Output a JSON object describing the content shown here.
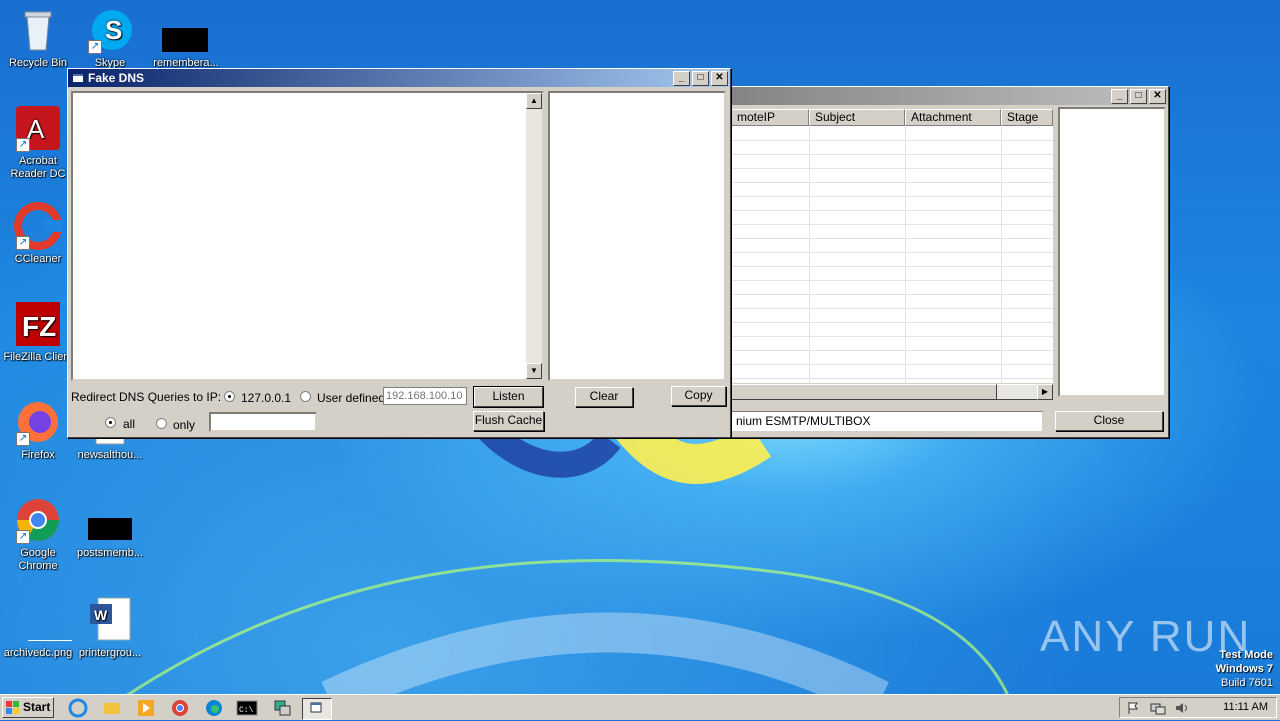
{
  "desktop": {
    "icons": [
      {
        "label": "Recycle Bin"
      },
      {
        "label": "Skype"
      },
      {
        "label": "remembera..."
      },
      {
        "label": "Acrobat Reader DC"
      },
      {
        "label": "CCleaner"
      },
      {
        "label": "FileZilla Client"
      },
      {
        "label": "Firefox"
      },
      {
        "label": "newsalthou..."
      },
      {
        "label": "Google Chrome"
      },
      {
        "label": "postsmemb..."
      },
      {
        "label": "archivedc.png"
      },
      {
        "label": "printergrou..."
      }
    ],
    "watermark": {
      "line1": "Test Mode",
      "line2": "Windows 7",
      "line3": "Build 7601"
    },
    "brand": "ANY RUN"
  },
  "fake_dns": {
    "title": "Fake DNS",
    "redirect_label": "Redirect DNS Queries to IP:",
    "radio_local": "127.0.0.1",
    "radio_user": "User defined",
    "ip_placeholder": "192.168.100.10",
    "listen_button": "Listen",
    "clear_button": "Clear",
    "copy_button": "Copy",
    "radio_all": "all",
    "radio_only": "only",
    "flush_button": "Flush Cache"
  },
  "mail_window": {
    "columns": [
      "moteIP",
      "Subject",
      "Attachment",
      "Stage"
    ],
    "banner": "nium ESMTP/MULTIBOX",
    "close_button": "Close"
  },
  "taskbar": {
    "start_label": "Start",
    "clock": "11:11 AM"
  }
}
